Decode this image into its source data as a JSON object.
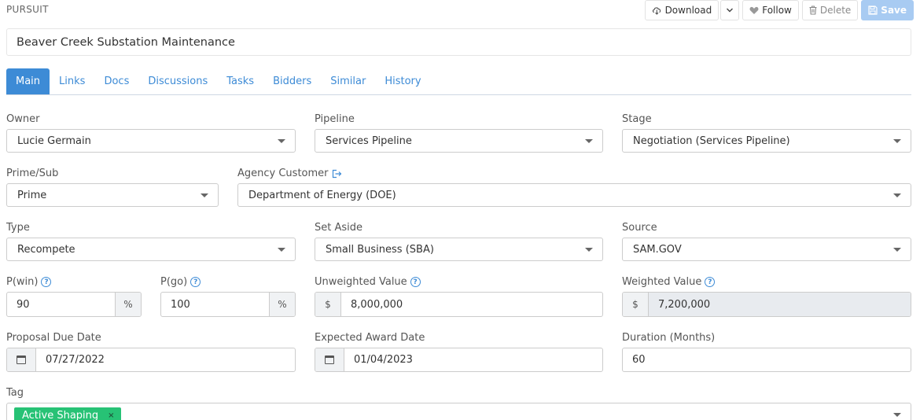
{
  "section_title": "PURSUIT",
  "toolbar": {
    "download": "Download",
    "follow": "Follow",
    "delete": "Delete",
    "save": "Save"
  },
  "pursuit_name": "Beaver Creek Substation Maintenance",
  "tabs": [
    "Main",
    "Links",
    "Docs",
    "Discussions",
    "Tasks",
    "Bidders",
    "Similar",
    "History"
  ],
  "fields": {
    "owner": {
      "label": "Owner",
      "value": "Lucie Germain"
    },
    "pipeline": {
      "label": "Pipeline",
      "value": "Services Pipeline"
    },
    "stage": {
      "label": "Stage",
      "value": "Negotiation (Services Pipeline)"
    },
    "prime_sub": {
      "label": "Prime/Sub",
      "value": "Prime"
    },
    "agency": {
      "label": "Agency Customer",
      "value": "Department of Energy (DOE)"
    },
    "type": {
      "label": "Type",
      "value": "Recompete"
    },
    "set_aside": {
      "label": "Set Aside",
      "value": "Small Business (SBA)"
    },
    "source": {
      "label": "Source",
      "value": "SAM.GOV"
    },
    "p_win": {
      "label": "P(win)",
      "value": "90",
      "unit": "%"
    },
    "p_go": {
      "label": "P(go)",
      "value": "100",
      "unit": "%"
    },
    "unweighted": {
      "label": "Unweighted Value",
      "currency": "$",
      "value": "8,000,000"
    },
    "weighted": {
      "label": "Weighted Value",
      "currency": "$",
      "value": "7,200,000"
    },
    "proposal_due": {
      "label": "Proposal Due Date",
      "value": "07/27/2022"
    },
    "award_date": {
      "label": "Expected Award Date",
      "value": "01/04/2023"
    },
    "duration": {
      "label": "Duration (Months)",
      "value": "60"
    },
    "tag": {
      "label": "Tag",
      "chips": [
        "Active Shaping"
      ],
      "remove": "×"
    }
  },
  "icons": {
    "help": "?"
  }
}
